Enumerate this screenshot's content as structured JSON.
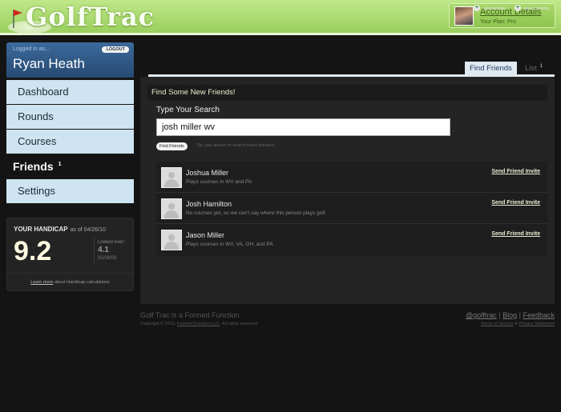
{
  "header": {
    "logo_text": "GolfTrac",
    "account_link": "Account Details",
    "plan_text": "Your Plan: Pro"
  },
  "user": {
    "logged_in_label": "Logged in as...",
    "logout_label": "LOGOUT",
    "name": "Ryan Heath"
  },
  "nav": {
    "dashboard": "Dashboard",
    "rounds": "Rounds",
    "courses": "Courses",
    "friends": "Friends",
    "friends_badge": "1",
    "settings": "Settings"
  },
  "handicap": {
    "label": "YOUR HANDICAP",
    "as_of": "as of 04/26/10",
    "value": "9.2",
    "lowest_label": "Lowest ever:",
    "lowest_value": "4.1",
    "lowest_date": "05/08/09",
    "learn_more": "Learn more",
    "foot_rest": " about Handicap calculations"
  },
  "actions": {
    "new_round": "NEW ROUND",
    "new_course": "NEW COURSE"
  },
  "tabs": {
    "find": "Find Friends",
    "list": "List",
    "list_badge": "1"
  },
  "search": {
    "heading": "Find Some New Friends!",
    "label": "Type Your Search",
    "value": "josh miller wv",
    "button": "Find Friends",
    "tip": "Tip: use quotes to search exact phrases"
  },
  "results": [
    {
      "name": "Joshua Miller",
      "sub": "Plays courses in WV and PA",
      "invite": "Send Friend Invite"
    },
    {
      "name": "Josh Hamilton",
      "sub": "No courses yet, so we can't say where this person plays golf",
      "invite": "Send Friend Invite"
    },
    {
      "name": "Jason Miller",
      "sub": "Plays courses in WV, VA, OH, and PA",
      "invite": "Send Friend Invite"
    }
  ],
  "footer": {
    "brand": "Golf Trac is a Formed Function.",
    "copy_pre": "Copyright © 2010, ",
    "copy_link": "Formed Function LLC",
    "copy_post": ". All rights reserved.",
    "twitter": "@golftrac",
    "sep": " | ",
    "blog": "Blog",
    "feedback": "Feedback",
    "terms": "Terms of Service",
    "amp": " & ",
    "privacy": "Privacy Statement"
  }
}
